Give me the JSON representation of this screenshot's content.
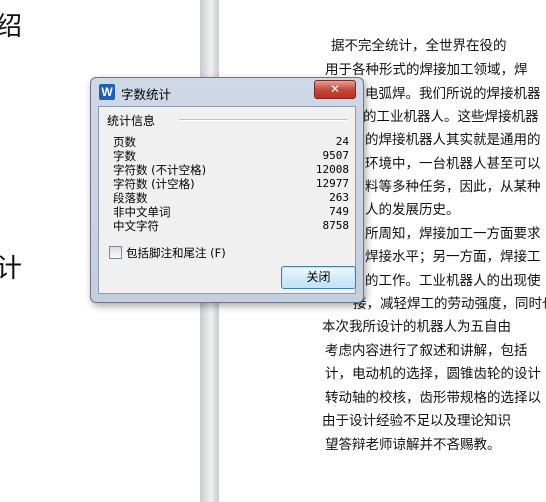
{
  "document": {
    "left_fragments": [
      "绍",
      "计"
    ],
    "right_lines": [
      "    据不完全统计，全世界在役的",
      "用于各种形式的焊接加工领域，焊",
      "电弧焊。我们所说的焊接机器",
      "的工业机器人。这些焊接机器",
      "的焊接机器人其实就是通用的",
      "环境中，一台机器人甚至可以",
      "料等多种任务，因此，从某种",
      "人的发展历史。",
      "所周知，焊接加工一方面要求",
      "焊接水平；另一方面，焊接工",
      "的工作。工业机器人的出现使",
      "接，减轻焊工的劳动强度，同时也可",
      "    本次我所设计的机器人为五自由",
      "考虑内容进行了叙述和讲解，包括",
      "计，电动机的选择，圆锥齿轮的设计",
      "转动轴的校核，齿形带规格的选择以",
      "    由于设计经验不足以及理论知识",
      "望答辩老师谅解并不吝赐教。"
    ]
  },
  "dialog": {
    "title": "字数统计",
    "app_icon_letter": "W",
    "close_glyph": "✕",
    "group_title": "统计信息",
    "stats": [
      {
        "label": "页数",
        "value": "24"
      },
      {
        "label": "字数",
        "value": "9507"
      },
      {
        "label": "字符数 (不计空格)",
        "value": "12008"
      },
      {
        "label": "字符数 (计空格)",
        "value": "12977"
      },
      {
        "label": "段落数",
        "value": "263"
      },
      {
        "label": "非中文单词",
        "value": "749"
      },
      {
        "label": "中文字符",
        "value": "8758"
      }
    ],
    "checkbox_label": "包括脚注和尾注 (F)",
    "checkbox_checked": false,
    "ok_label": "关闭"
  }
}
